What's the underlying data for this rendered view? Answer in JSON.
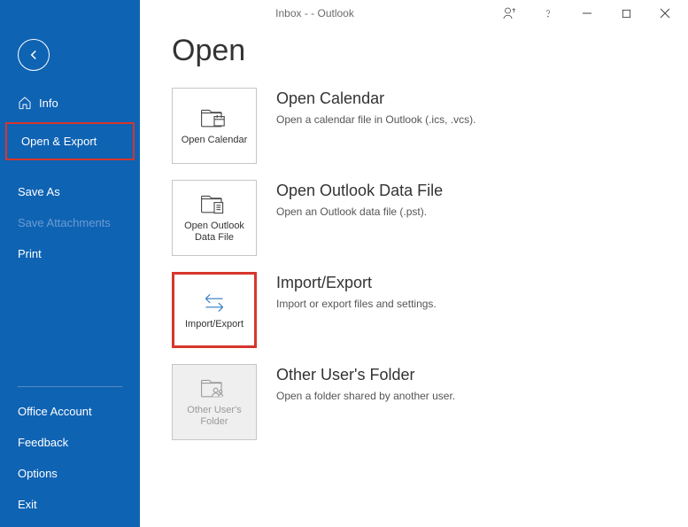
{
  "titlebar": {
    "text": "Inbox -   -  Outlook"
  },
  "sidebar": {
    "info": "Info",
    "open_export": "Open & Export",
    "save_as": "Save As",
    "save_attachments": "Save Attachments",
    "print": "Print",
    "office_account": "Office Account",
    "feedback": "Feedback",
    "options": "Options",
    "exit": "Exit"
  },
  "page": {
    "title": "Open",
    "options": {
      "open_calendar": {
        "tile": "Open Calendar",
        "title": "Open Calendar",
        "desc": "Open a calendar file in Outlook (.ics, .vcs)."
      },
      "open_data_file": {
        "tile": "Open Outlook Data File",
        "title": "Open Outlook Data File",
        "desc": "Open an Outlook data file (.pst)."
      },
      "import_export": {
        "tile": "Import/Export",
        "title": "Import/Export",
        "desc": "Import or export files and settings."
      },
      "other_user": {
        "tile": "Other User's Folder",
        "title": "Other User's Folder",
        "desc": "Open a folder shared by another user."
      }
    }
  }
}
